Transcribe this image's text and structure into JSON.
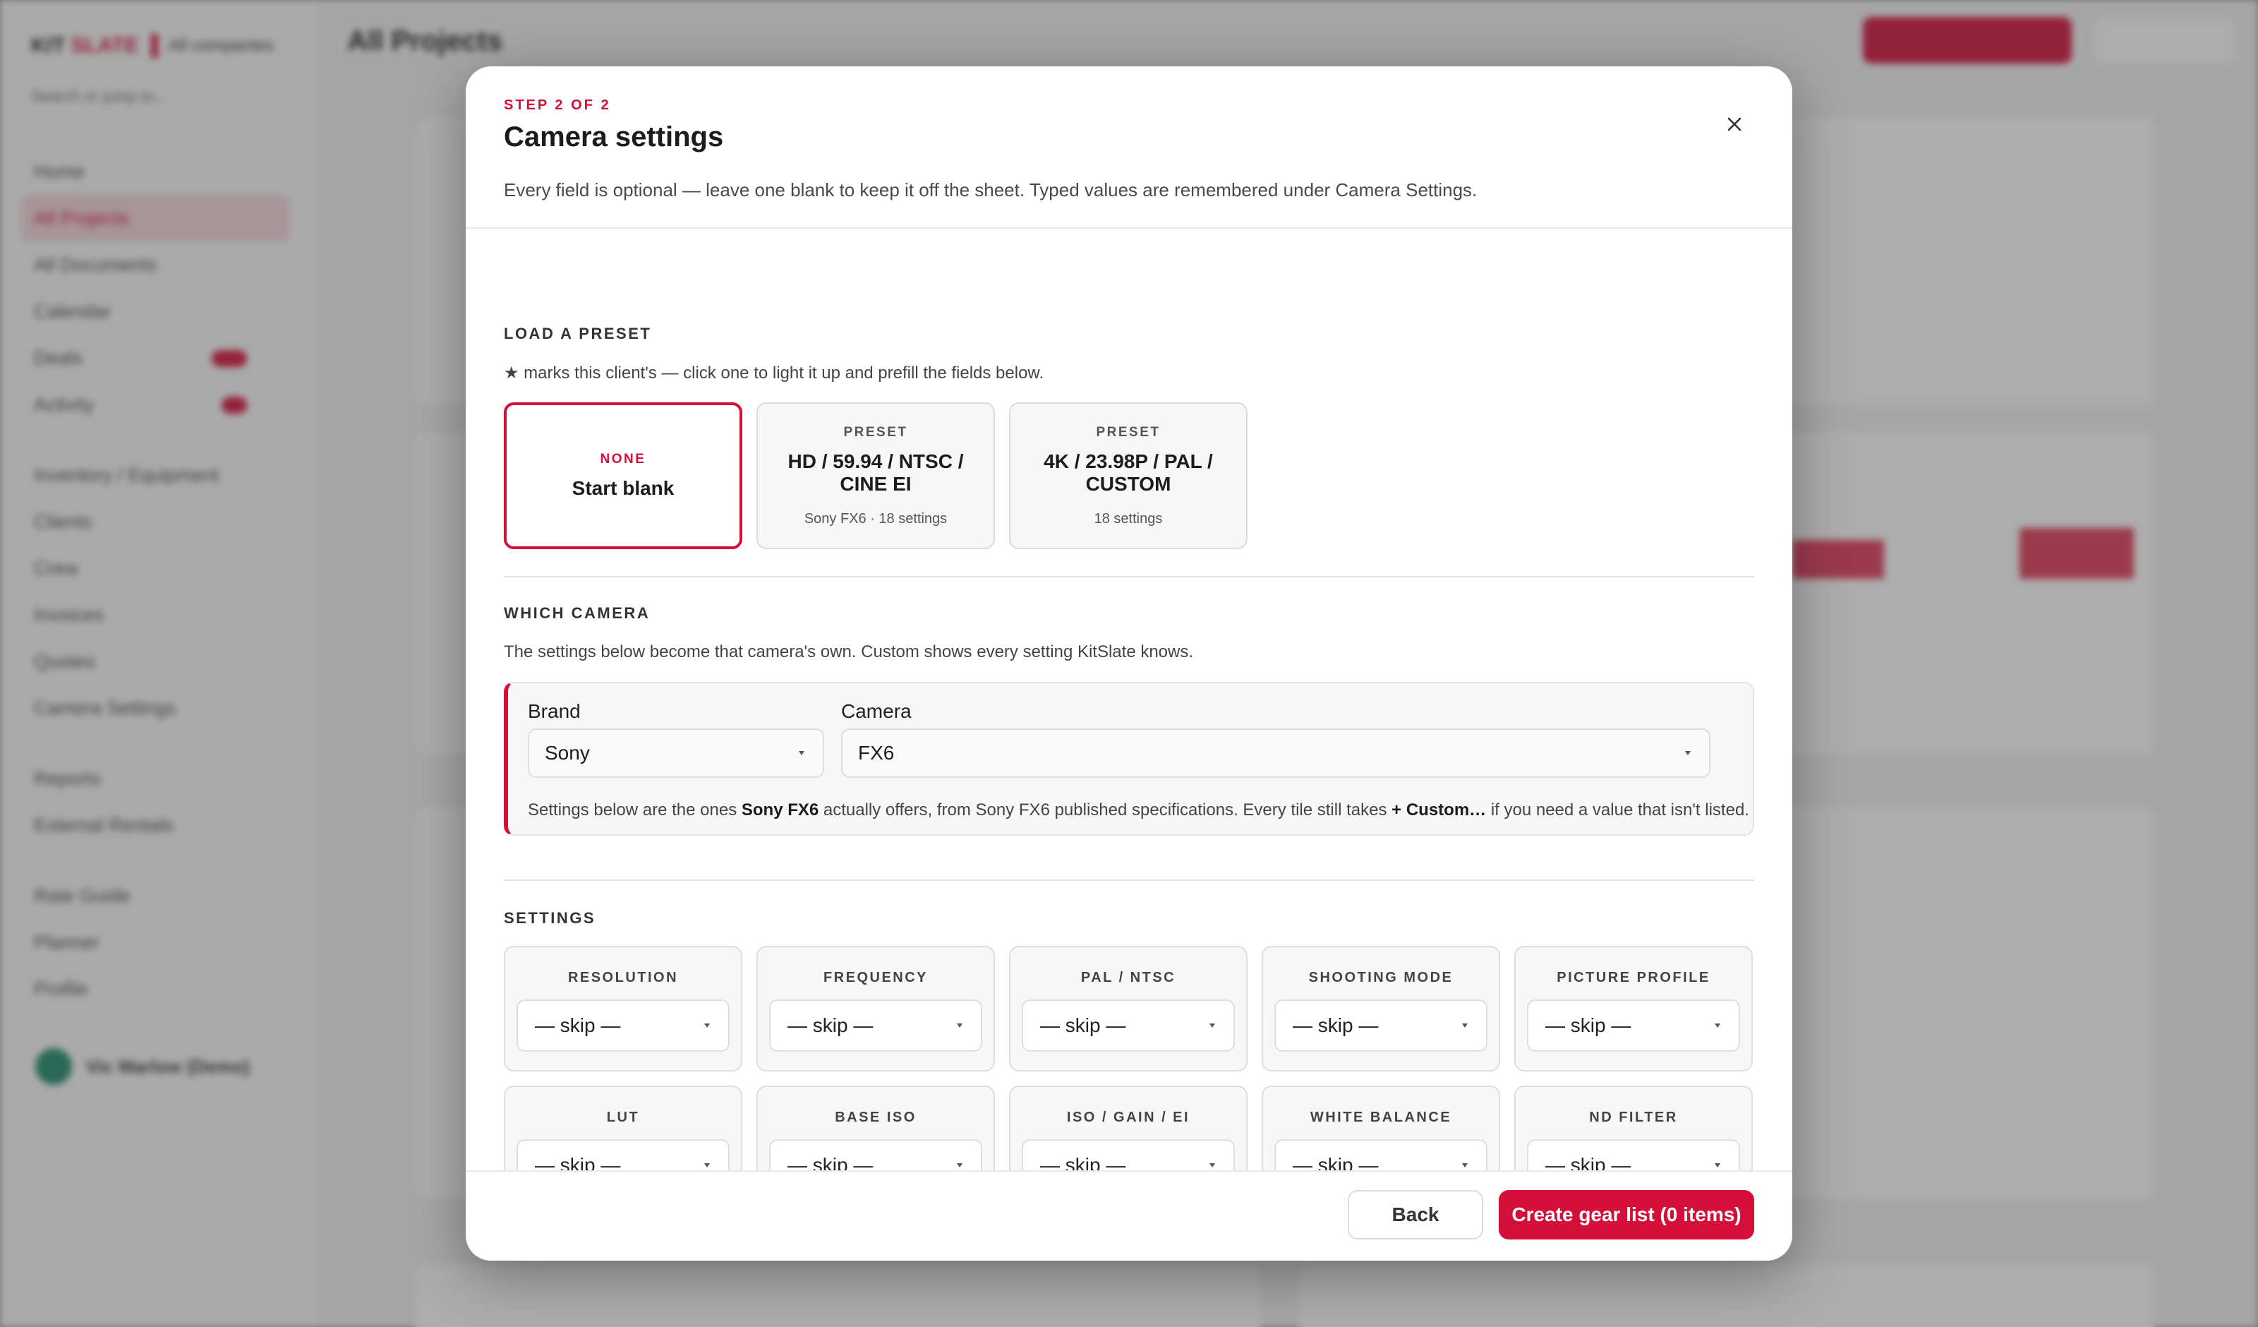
{
  "background": {
    "logo_kit": "KIT",
    "logo_slate": "SLATE",
    "company": "All companies",
    "search_placeholder": "Search or jump to...",
    "page_title": "All Projects",
    "nav": [
      "Home",
      "All Projects",
      "All Documents",
      "Calendar",
      "Deals",
      "Activity",
      "Inventory / Equipment",
      "Clients",
      "Crew",
      "Invoices",
      "Quotes",
      "Camera Settings",
      "Reports",
      "External Rentals",
      "Rate Guide",
      "Planner",
      "Profile"
    ],
    "user_name": "Vic Marlow (Demo)"
  },
  "modal": {
    "step": "STEP 2 OF 2",
    "title": "Camera settings",
    "subtitle": "Every field is optional — leave one blank to keep it off the sheet. Typed values are remembered under Camera Settings.",
    "preset_section": {
      "heading": "LOAD A PRESET",
      "hint": "★ marks this client's — click one to light it up and prefill the fields below.",
      "presets": [
        {
          "tag": "NONE",
          "name": "Start blank",
          "meta": ""
        },
        {
          "tag": "PRESET",
          "name": "HD / 59.94 / NTSC / CINE EI",
          "meta": "Sony FX6 · 18 settings"
        },
        {
          "tag": "PRESET",
          "name": "4K / 23.98P / PAL / CUSTOM",
          "meta": "18 settings"
        }
      ]
    },
    "camera_section": {
      "heading": "WHICH CAMERA",
      "hint": "The settings below become that camera's own. Custom shows every setting KitSlate knows.",
      "brand_label": "Brand",
      "brand_value": "Sony",
      "camera_label": "Camera",
      "camera_value": "FX6",
      "note_a": "Settings below are the ones ",
      "note_cam": "Sony FX6",
      "note_b": " actually offers, from Sony FX6 published specifications. Every tile still takes ",
      "note_custom": "+ Custom…",
      "note_c": " if you need a value that isn't listed."
    },
    "settings_section": {
      "heading": "SETTINGS",
      "tiles": [
        {
          "label": "RESOLUTION",
          "value": "— skip —"
        },
        {
          "label": "FREQUENCY",
          "value": "— skip —"
        },
        {
          "label": "PAL / NTSC",
          "value": "— skip —"
        },
        {
          "label": "SHOOTING MODE",
          "value": "— skip —"
        },
        {
          "label": "PICTURE PROFILE",
          "value": "— skip —"
        },
        {
          "label": "LUT",
          "value": "— skip —"
        },
        {
          "label": "BASE ISO",
          "value": "— skip —"
        },
        {
          "label": "ISO / GAIN / EI",
          "value": "— skip —"
        },
        {
          "label": "WHITE BALANCE",
          "value": "— skip —"
        },
        {
          "label": "ND FILTER",
          "value": "— skip —"
        }
      ]
    },
    "footer": {
      "back_label": "Back",
      "create_label": "Create gear list (0 items)"
    }
  },
  "colors": {
    "accent": "#d40f3a",
    "border": "#dedede",
    "tile_bg": "#f7f7f7"
  }
}
